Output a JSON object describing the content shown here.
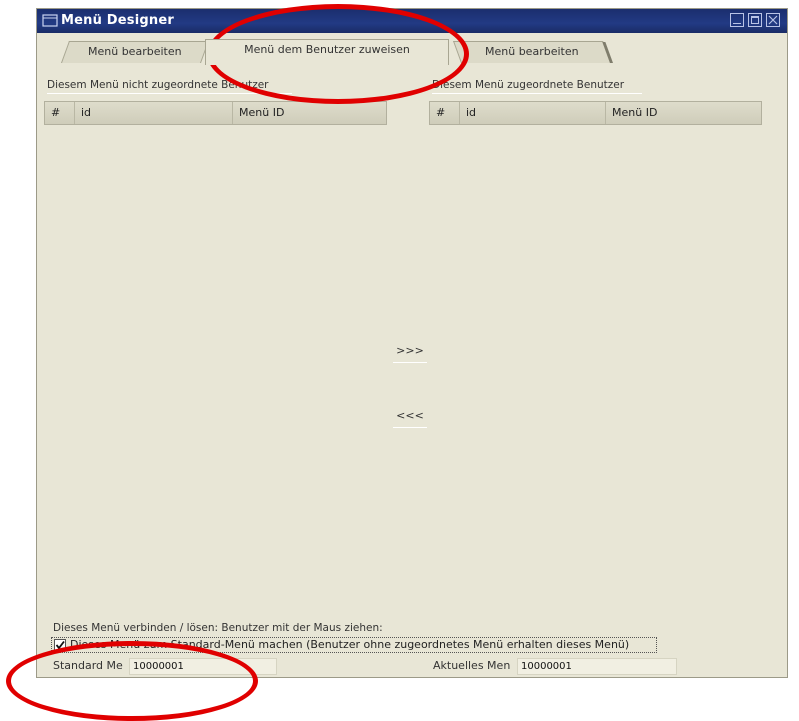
{
  "window": {
    "title": "Menü Designer"
  },
  "tabs": [
    {
      "label": "Menü bearbeiten"
    },
    {
      "label": "Menü dem Benutzer zuweisen"
    },
    {
      "label": "Menü bearbeiten"
    }
  ],
  "left_panel": {
    "label": "Diesem Menü nicht zugeordnete Benutzer",
    "columns": [
      "#",
      "id",
      "Menü ID"
    ]
  },
  "right_panel": {
    "label": "Diesem Menü zugeordnete Benutzer",
    "columns": [
      "#",
      "id",
      "Menü ID"
    ]
  },
  "buttons": {
    "assign": ">>>",
    "unassign": "<<<"
  },
  "hint": "Dieses Menü verbinden / lösen: Benutzer mit der Maus ziehen:",
  "default_checkbox": {
    "label": "Dieses Menü zum Standard-Menü machen (Benutzer ohne zugeordnetes Menü erhalten dieses Menü)",
    "checked": true
  },
  "fields": {
    "standard_label": "Standard Me",
    "standard_value": "10000001",
    "current_label": "Aktuelles Men",
    "current_value": "10000001"
  },
  "colors": {
    "annotation_ring": "#e00000",
    "titlebar": "#223a84",
    "window_bg": "#e8e6d6"
  },
  "icons": [
    "window-app-icon",
    "minimize-icon",
    "maximize-icon",
    "close-icon",
    "checkmark-icon"
  ]
}
